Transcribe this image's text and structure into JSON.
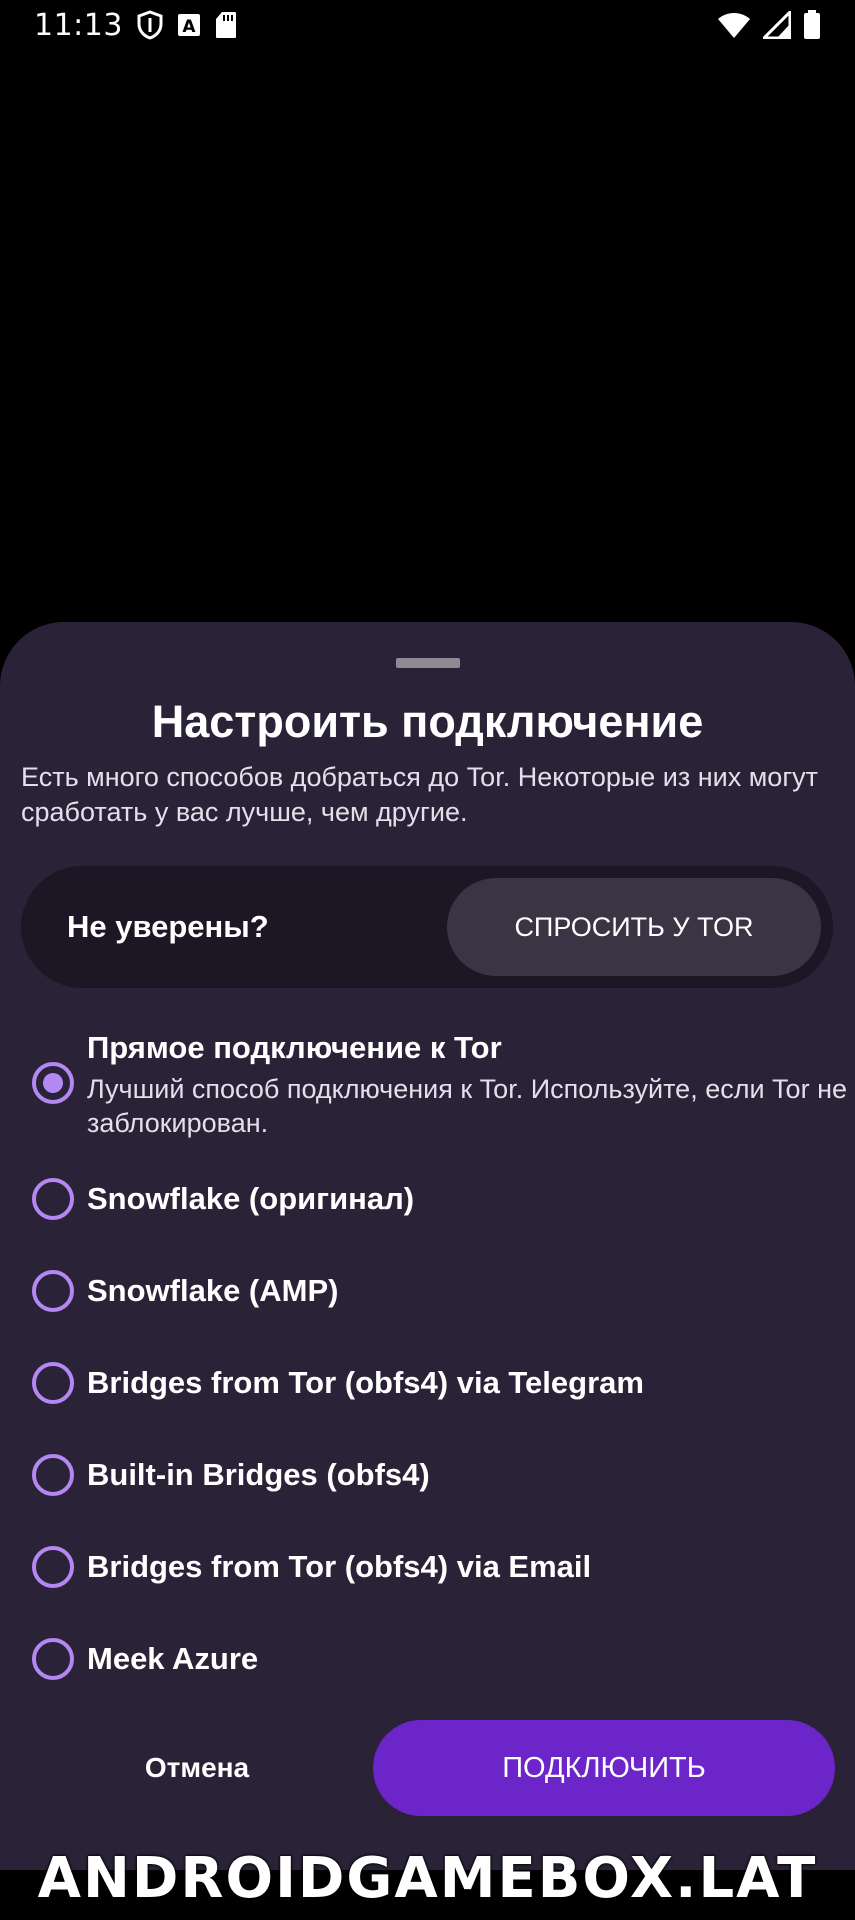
{
  "status_bar": {
    "time": "11:13",
    "icons": [
      "shield-icon",
      "font-a-icon",
      "sd-card-icon",
      "wifi-icon",
      "cell-signal-icon",
      "battery-icon"
    ]
  },
  "sheet": {
    "title": "Настроить подключение",
    "description": "Есть много способов добраться до Tor. Некоторые из них могут сработать у вас лучше, чем другие.",
    "unsure": {
      "label": "Не уверены?",
      "button": "СПРОСИТЬ У TOR"
    },
    "options": [
      {
        "title": "Прямое подключение к Tor",
        "description": "Лучший способ подключения к Tor. Используйте, если Tor не заблокирован.",
        "selected": true
      },
      {
        "title": "Snowflake (оригинал)",
        "selected": false
      },
      {
        "title": "Snowflake (AMP)",
        "selected": false
      },
      {
        "title": "Bridges from Tor (obfs4) via Telegram",
        "selected": false
      },
      {
        "title": "Built-in Bridges (obfs4)",
        "selected": false
      },
      {
        "title": "Bridges from Tor (obfs4) via Email",
        "selected": false
      },
      {
        "title": "Meek Azure",
        "selected": false
      }
    ],
    "cancel_label": "Отмена",
    "connect_label": "ПОДКЛЮЧИТЬ"
  },
  "colors": {
    "sheet_background": "#2a2237",
    "card_background": "#1c1625",
    "accent": "#6c25c9",
    "radio": "#b388f3"
  },
  "watermark": "ANDROIDGAMEBOX.LAT"
}
